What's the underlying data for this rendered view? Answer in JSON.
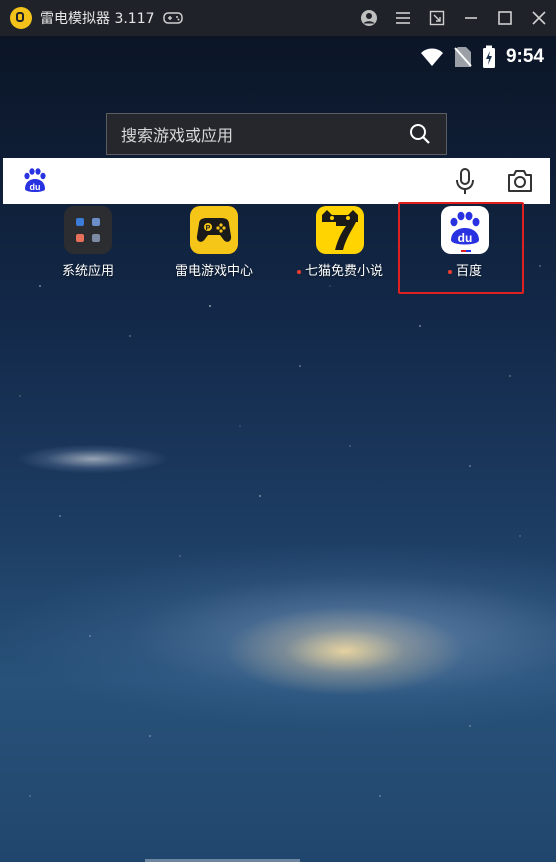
{
  "window": {
    "title": "雷电模拟器 3.117",
    "controls": [
      "account",
      "menu",
      "minimize-to-side",
      "minimize",
      "maximize",
      "close"
    ]
  },
  "status_bar": {
    "time": "9:54",
    "icons": [
      "wifi-icon",
      "no-sim-icon",
      "battery-charging-icon"
    ]
  },
  "search": {
    "placeholder": "搜索游戏或应用"
  },
  "baidu_bar": {
    "logo": "du",
    "icons": [
      "baidu-paw-icon",
      "microphone-icon",
      "camera-icon"
    ]
  },
  "apps": [
    {
      "label": "系统应用",
      "new": false
    },
    {
      "label": "雷电游戏中心",
      "new": false
    },
    {
      "label": "七猫免费小说",
      "new": true
    },
    {
      "label": "百度",
      "new": true
    }
  ],
  "highlighted_app": "百度",
  "colors": {
    "titlebar": "#1f2229",
    "highlight": "#e02020",
    "baidu_blue": "#2932e1",
    "accent_yellow": "#f5c518"
  }
}
